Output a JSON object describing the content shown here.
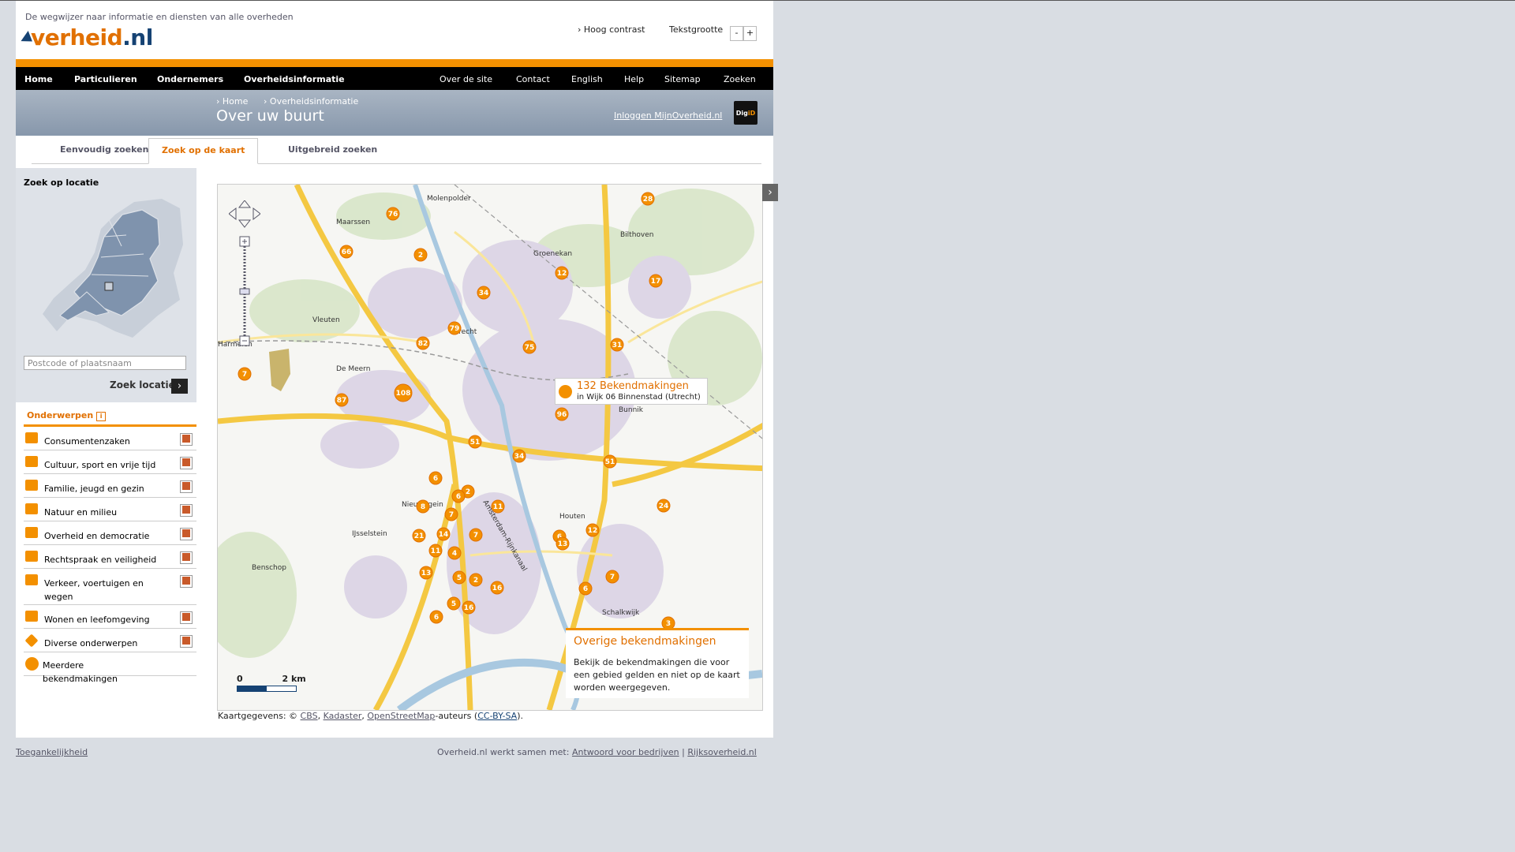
{
  "header": {
    "tagline": "De wegwijzer naar informatie en diensten van alle overheden",
    "logo_main": "verheid",
    "logo_tld": ".nl",
    "high_contrast": "Hoog contrast",
    "text_size": "Tekstgrootte",
    "minus": "-",
    "plus": "+"
  },
  "nav": {
    "left": [
      "Home",
      "Particulieren",
      "Ondernemers",
      "Overheidsinformatie"
    ],
    "right": [
      "Over de site",
      "Contact",
      "English",
      "Help",
      "Sitemap",
      "Zoeken"
    ]
  },
  "breadcrumb": [
    "Home",
    "Overheidsinformatie"
  ],
  "page_title": "Over uw buurt",
  "login": "Inloggen MijnOverheid.nl",
  "digid": {
    "a": "Dig",
    "b": "iD"
  },
  "tabs": [
    "Eenvoudig zoeken",
    "Zoek op de kaart",
    "Uitgebreid zoeken"
  ],
  "active_tab": 1,
  "sidebar": {
    "title": "Zoek op locatie",
    "placeholder": "Postcode of plaatsnaam",
    "search_button": "Zoek locatie",
    "subjects_title": "Onderwerpen",
    "subjects": [
      {
        "label": "Consumentenzaken",
        "checked": true
      },
      {
        "label": "Cultuur, sport en vrije tijd",
        "checked": true
      },
      {
        "label": "Familie, jeugd en gezin",
        "checked": true
      },
      {
        "label": "Natuur en milieu",
        "checked": true
      },
      {
        "label": "Overheid en democratie",
        "checked": true
      },
      {
        "label": "Rechtspraak en veiligheid",
        "checked": true
      },
      {
        "label": "Verkeer, voertuigen en wegen",
        "checked": true
      },
      {
        "label": "Wonen en leefomgeving",
        "checked": true
      },
      {
        "label": "Diverse onderwerpen",
        "checked": true
      }
    ],
    "more": "Meerdere bekendmakingen"
  },
  "map": {
    "places": [
      "Maarssen",
      "Molenpolder",
      "Groenekan",
      "Bilthoven",
      "Vleuten",
      "Utrecht",
      "De Meern",
      "Harmelen",
      "Bunnik",
      "Nieuwegein",
      "IJsselstein",
      "Houten",
      "Benschop",
      "Amsterdam-Rijnkanaal",
      "Schalkwijk"
    ],
    "markers": [
      "76",
      "66",
      "2",
      "12",
      "28",
      "17",
      "34",
      "79",
      "82",
      "75",
      "31",
      "108",
      "87",
      "7",
      "96",
      "51",
      "34",
      "51",
      "6",
      "2",
      "6",
      "11",
      "24",
      "8",
      "7",
      "21",
      "14",
      "7",
      "11",
      "4",
      "6",
      "12",
      "13",
      "13",
      "5",
      "2",
      "16",
      "7",
      "6",
      "5",
      "16",
      "3",
      "6"
    ],
    "popup_count": "132 Bekendmakingen",
    "popup_area": "in Wijk 06 Binnenstad (Utrecht)",
    "other_title": "Overige bekendmakingen",
    "other_text": "Bekijk de bekendmakingen die voor een gebied gelden en niet op de kaart worden weergegeven.",
    "scale_0": "0",
    "scale_km": "2 km"
  },
  "credits": {
    "prefix": "Kaartgegevens: © ",
    "cbs": "CBS",
    "kadaster": "Kadaster",
    "osm": "OpenStreetMap",
    "mid": "-auteurs (",
    "license": "CC-BY-SA",
    "end": ")."
  },
  "footer": {
    "left": "Toegankelijkheid",
    "right_prefix": "Overheid.nl werkt samen met: ",
    "link1": "Antwoord voor bedrijven",
    "sep": " | ",
    "link2": "Rijksoverheid.nl"
  },
  "colors": {
    "accent": "#f39000",
    "brand": "#e17000",
    "navy": "#154273"
  }
}
